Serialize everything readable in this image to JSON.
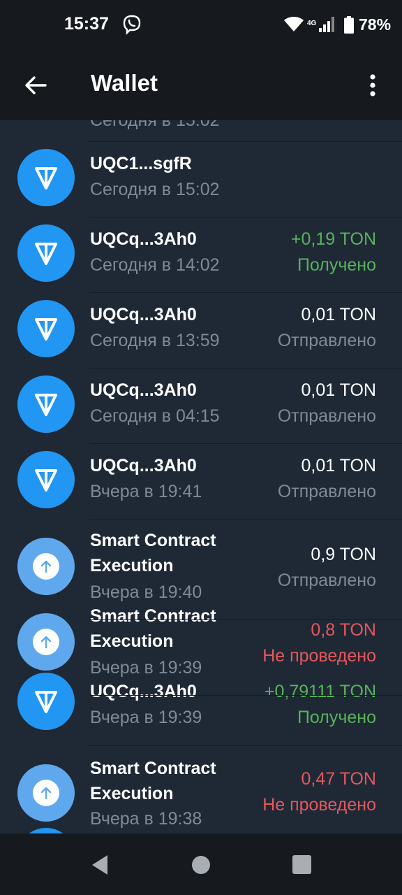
{
  "status_bar": {
    "time": "15:37",
    "network": "4G",
    "battery": "78%"
  },
  "app_bar": {
    "title": "Wallet"
  },
  "partial_top": {
    "time": "Сегодня в 15:02"
  },
  "transactions": [
    {
      "title": "UQC1...sgfR",
      "time": "Сегодня в 15:02",
      "amount": "",
      "status": ""
    },
    {
      "title": "UQCq...3Ah0",
      "time": "Сегодня в 14:02",
      "amount": "+0,19 TON",
      "status": "Получено"
    },
    {
      "title": "UQCq...3Ah0",
      "time": "Сегодня в 13:59",
      "amount": "0,01 TON",
      "status": "Отправлено"
    },
    {
      "title": "UQCq...3Ah0",
      "time": "Сегодня в 04:15",
      "amount": "0,01 TON",
      "status": "Отправлено"
    },
    {
      "title": "UQCq...3Ah0",
      "time": "Вчера в 19:41",
      "amount": "0,01 TON",
      "status": "Отправлено"
    },
    {
      "title": "Smart Contract Execution",
      "time": "Вчера в 19:40",
      "amount": "0,9 TON",
      "status": "Отправлено"
    },
    {
      "title": "Smart Contract Execution",
      "time": "Вчера в 19:39",
      "amount": "0,8 TON",
      "status": "Не проведено"
    },
    {
      "title": "UQCq...3Ah0",
      "time": "Вчера в 19:39",
      "amount": "+0,79111 TON",
      "status": "Получено"
    },
    {
      "title": "Smart Contract Execution",
      "time": "Вчера в 19:38",
      "amount": "0,47 TON",
      "status": "Не проведено"
    }
  ],
  "colors": {
    "background": "#1f2936",
    "bars": "#161a1e",
    "ton_blue": "#2196f3",
    "contract_blue": "#5fa8ee",
    "received_green": "#58b359",
    "failed_red": "#e5575c",
    "secondary_grey": "#7e8a97"
  },
  "icons": {
    "ton": "ton-logo-icon",
    "contract": "arrow-up-icon"
  }
}
